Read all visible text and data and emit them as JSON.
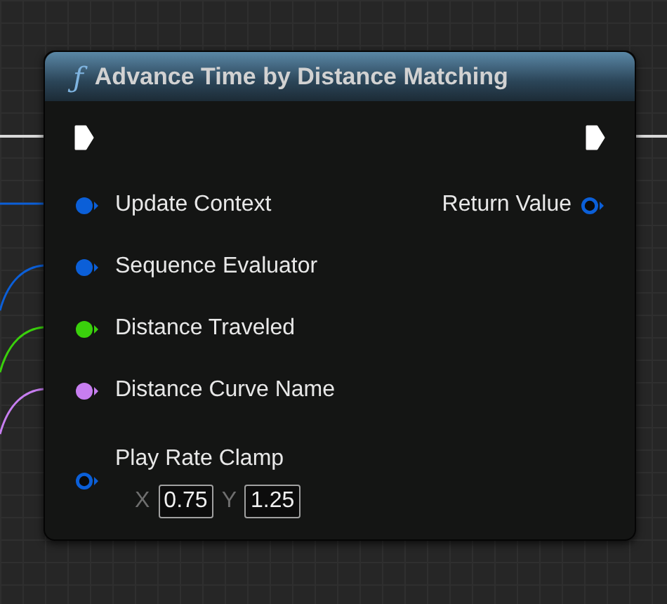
{
  "node": {
    "icon": "ƒ",
    "title": "Advance Time by Distance Matching"
  },
  "exec": {
    "input_connected": true,
    "output_connected": true
  },
  "inputs": [
    {
      "kind": "pin",
      "label": "Update Context",
      "color": "#0b5fd8",
      "connected": true
    },
    {
      "kind": "pin",
      "label": "Sequence Evaluator",
      "color": "#0b5fd8",
      "connected": true
    },
    {
      "kind": "pin",
      "label": "Distance Traveled",
      "color": "#3ad00c",
      "connected": true
    },
    {
      "kind": "pin",
      "label": "Distance Curve Name",
      "color": "#c77ef0",
      "connected": true
    },
    {
      "kind": "range",
      "label": "Play Rate Clamp",
      "color": "#0b5fd8",
      "connected": false,
      "fields": [
        {
          "axis": "X",
          "value": "0.75"
        },
        {
          "axis": "Y",
          "value": "1.25"
        }
      ]
    }
  ],
  "output": {
    "label": "Return Value",
    "color": "#0b5fd8",
    "connected": false
  }
}
